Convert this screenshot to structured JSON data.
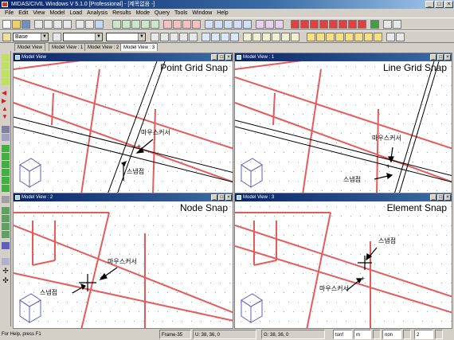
{
  "window": {
    "title": "MIDAS/CIVIL Windows V 5.1.0 [Professional] - [제목없음 -]"
  },
  "menu": [
    "File",
    "Edit",
    "View",
    "Model",
    "Load",
    "Analysis",
    "Results",
    "Mode",
    "Query",
    "Tools",
    "Window",
    "Help"
  ],
  "toolbar2": {
    "base_value": "Base"
  },
  "tabs": [
    "Model View",
    "Model View : 1",
    "Model View : 2",
    "Model View : 3"
  ],
  "views": [
    {
      "title": "Model View",
      "snap_label": "Point Grid Snap",
      "cursor_label": "마우스커서",
      "snap_point_label": "스냅점"
    },
    {
      "title": "Model View : 1",
      "snap_label": "Line Grid Snap",
      "cursor_label": "마우스커서",
      "snap_point_label": "스냅점"
    },
    {
      "title": "Model View : 2",
      "snap_label": "Node Snap",
      "cursor_label": "마우스커서",
      "snap_point_label": "스냅점"
    },
    {
      "title": "Model View : 3",
      "snap_label": "Element Snap",
      "cursor_label": "마우스커서",
      "snap_point_label": "스냅점"
    }
  ],
  "status": {
    "help": "For Help, press F1",
    "frame": "Frame-35",
    "u_coords": "U: 38, 36, 0",
    "g_coords": "G: 38, 36, 0",
    "unit_force": "tonf",
    "unit_length": "m",
    "mode": "non",
    "page_value": "2"
  },
  "colors": {
    "element_line": "#e85a5a",
    "grid_line": "#000000",
    "title_gradient_start": "#0a246a"
  }
}
